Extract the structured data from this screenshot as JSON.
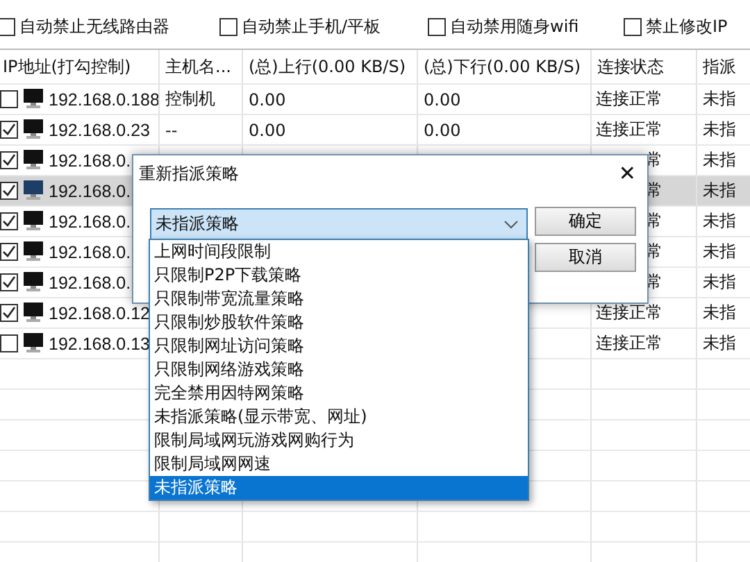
{
  "options": [
    {
      "label": "自动禁止无线路由器",
      "checked": false
    },
    {
      "label": "自动禁止手机/平板",
      "checked": false
    },
    {
      "label": "自动禁用随身wifi",
      "checked": false
    },
    {
      "label": "禁止修改IP",
      "checked": false
    }
  ],
  "table": {
    "columns": [
      "IP地址(打勾控制)",
      "主机名...",
      "(总)上行(0.00 KB/S)",
      "(总)下行(0.00 KB/S)",
      "连接状态",
      "指派"
    ],
    "rows": [
      {
        "checked": false,
        "selected": false,
        "ip": "192.168.0.188",
        "host": "控制机",
        "up": "0.00",
        "down": "0.00",
        "status": "连接正常",
        "strategy": "未指"
      },
      {
        "checked": true,
        "selected": false,
        "ip": "192.168.0.23",
        "host": "--",
        "up": "0.00",
        "down": "0.00",
        "status": "连接正常",
        "strategy": "未指"
      },
      {
        "checked": true,
        "selected": false,
        "ip": "192.168.0.",
        "status": "常",
        "strategy": "未指"
      },
      {
        "checked": true,
        "selected": true,
        "ip": "192.168.0.",
        "status": "常",
        "strategy": "未指"
      },
      {
        "checked": true,
        "selected": false,
        "ip": "192.168.0.",
        "status": "常",
        "strategy": "未指"
      },
      {
        "checked": true,
        "selected": false,
        "ip": "192.168.0.",
        "status": "常",
        "strategy": "未指"
      },
      {
        "checked": true,
        "selected": false,
        "ip": "192.168.0.",
        "status": "常",
        "strategy": "未指"
      },
      {
        "checked": true,
        "selected": false,
        "ip": "192.168.0.12",
        "status": "连接正常",
        "strategy": "未指"
      },
      {
        "checked": false,
        "selected": false,
        "ip": "192.168.0.13",
        "status": "连接正常",
        "strategy": "未指"
      }
    ]
  },
  "dialog": {
    "title": "重新指派策略",
    "close": "✕",
    "combo_value": "未指派策略",
    "buttons": [
      "确定",
      "取消"
    ],
    "options": [
      {
        "label": "上网时间段限制",
        "selected": false
      },
      {
        "label": "只限制P2P下载策略",
        "selected": false
      },
      {
        "label": "只限制带宽流量策略",
        "selected": false
      },
      {
        "label": "只限制炒股软件策略",
        "selected": false
      },
      {
        "label": "只限制网址访问策略",
        "selected": false
      },
      {
        "label": "只限制网络游戏策略",
        "selected": false
      },
      {
        "label": "完全禁用因特网策略",
        "selected": false
      },
      {
        "label": "未指派策略(显示带宽、网址)",
        "selected": false
      },
      {
        "label": "限制局域网玩游戏网购行为",
        "selected": false
      },
      {
        "label": "限制局域网网速",
        "selected": false
      },
      {
        "label": "未指派策略",
        "selected": true
      }
    ]
  }
}
